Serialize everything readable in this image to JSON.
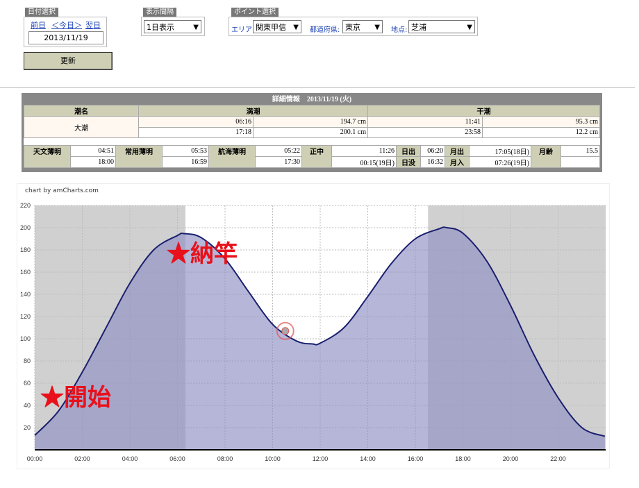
{
  "controls": {
    "date_group_title": "日付選択",
    "prev_day": "前日",
    "today": "＜今日＞",
    "next_day": "翌日",
    "date_value": "2013/11/19",
    "update_button": "更新",
    "interval_group_title": "表示間隔",
    "interval_value": "1日表示",
    "point_group_title": "ポイント選択",
    "area_label": "エリア:",
    "area_value": "関東甲信",
    "pref_label": "都道府県:",
    "pref_value": "東京",
    "spot_label": "地点:",
    "spot_value": "芝浦"
  },
  "info": {
    "title": "詳細情報　2013/11/19 (火)",
    "tide_name_header": "潮名",
    "high_tide_header": "満潮",
    "low_tide_header": "干潮",
    "tide_name": "大潮",
    "high": [
      {
        "time": "06:16",
        "level": "194.7 cm"
      },
      {
        "time": "17:18",
        "level": "200.1 cm"
      }
    ],
    "low": [
      {
        "time": "11:41",
        "level": "95.3 cm"
      },
      {
        "time": "23:58",
        "level": "12.2 cm"
      }
    ],
    "astro": {
      "civil_label": "天文薄明",
      "civil": [
        "04:51",
        "18:00"
      ],
      "common_label": "常用薄明",
      "common": [
        "05:53",
        "16:59"
      ],
      "nautical_label": "航海薄明",
      "nautical": [
        "05:22",
        "17:30"
      ],
      "noon_label": "正中",
      "noon": [
        "11:26",
        "00:15(19日)"
      ],
      "sunrise_label": "日出",
      "sunrise": "06:20",
      "sunset_label": "日没",
      "sunset": "16:32",
      "moonrise_label": "月出",
      "moonrise": "17:05(18日)",
      "moonset_label": "月入",
      "moonset": "07:26(19日)",
      "moon_age_label": "月齢",
      "moon_age": "15.5"
    }
  },
  "chart_credit": "chart by amCharts.com",
  "chart_data": {
    "type": "area",
    "x": [
      "00:00",
      "01:00",
      "02:00",
      "03:00",
      "04:00",
      "05:00",
      "06:00",
      "06:16",
      "07:00",
      "08:00",
      "09:00",
      "10:00",
      "11:00",
      "11:41",
      "12:00",
      "13:00",
      "14:00",
      "15:00",
      "16:00",
      "17:00",
      "17:18",
      "18:00",
      "19:00",
      "20:00",
      "21:00",
      "22:00",
      "23:00",
      "23:58"
    ],
    "y": [
      13,
      35,
      70,
      110,
      150,
      180,
      193,
      194.7,
      191,
      172,
      142,
      113,
      98,
      95.3,
      96,
      110,
      138,
      168,
      190,
      199,
      200.1,
      195,
      170,
      130,
      85,
      47,
      20,
      12.2
    ],
    "x_ticks": [
      "00:00",
      "02:00",
      "04:00",
      "06:00",
      "08:00",
      "10:00",
      "12:00",
      "14:00",
      "16:00",
      "18:00",
      "20:00",
      "22:00"
    ],
    "y_ticks": [
      20,
      40,
      60,
      80,
      100,
      120,
      140,
      160,
      180,
      200,
      220
    ],
    "ylim": [
      0,
      220
    ],
    "xlim": [
      "00:00",
      "24:00"
    ],
    "grid": true,
    "night_shading": true,
    "daylight_band": [
      "06:20",
      "16:32"
    ],
    "current_marker": {
      "x": "10:32",
      "y": 107
    },
    "colors": {
      "fill": "#8f8fc4",
      "line": "#1a1f6e",
      "night": "#d0d0d0",
      "marker": "#e05555"
    }
  },
  "annotations": {
    "start_label": "★開始",
    "stop_label": "★納竿"
  }
}
